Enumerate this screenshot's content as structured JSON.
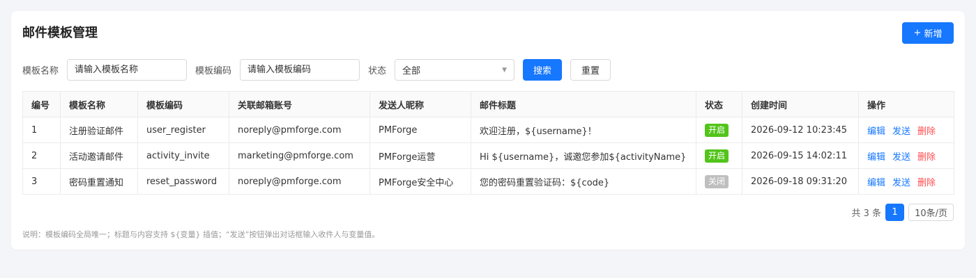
{
  "header": {
    "title": "邮件模板管理",
    "add_label": "新增"
  },
  "filters": {
    "name_label": "模板名称",
    "name_placeholder": "请输入模板名称",
    "code_label": "模板编码",
    "code_placeholder": "请输入模板编码",
    "status_label": "状态",
    "status_value": "全部",
    "search_label": "搜索",
    "reset_label": "重置"
  },
  "table": {
    "headers": [
      "编号",
      "模板名称",
      "模板编码",
      "关联邮箱账号",
      "发送人昵称",
      "邮件标题",
      "状态",
      "创建时间",
      "操作"
    ],
    "rows": [
      {
        "id": "1",
        "name": "注册验证邮件",
        "code": "user_register",
        "email": "noreply@pmforge.com",
        "sender": "PMForge",
        "subject": "欢迎注册，${username}！",
        "status": "开启",
        "created": "2026-09-12 10:23:45"
      },
      {
        "id": "2",
        "name": "活动邀请邮件",
        "code": "activity_invite",
        "email": "marketing@pmforge.com",
        "sender": "PMForge运营",
        "subject": "Hi ${username}，诚邀您参加${activityName}",
        "status": "开启",
        "created": "2026-09-15 14:02:11"
      },
      {
        "id": "3",
        "name": "密码重置通知",
        "code": "reset_password",
        "email": "noreply@pmforge.com",
        "sender": "PMForge安全中心",
        "subject": "您的密码重置验证码：${code}",
        "status": "关闭",
        "created": "2026-09-18 09:31:20"
      }
    ],
    "actions": {
      "edit": "编辑",
      "send": "发送",
      "delete": "删除"
    }
  },
  "pagination": {
    "total_text": "共 3 条",
    "current_page": "1",
    "page_size": "10条/页"
  },
  "note": "说明：模板编码全局唯一；标题与内容支持 ${变量} 插值；“发送”按钮弹出对话框输入收件人与变量值。",
  "colors": {
    "primary": "#1677ff",
    "success": "#52c41a",
    "danger": "#ff4d4f",
    "disabled": "#bfbfbf"
  }
}
